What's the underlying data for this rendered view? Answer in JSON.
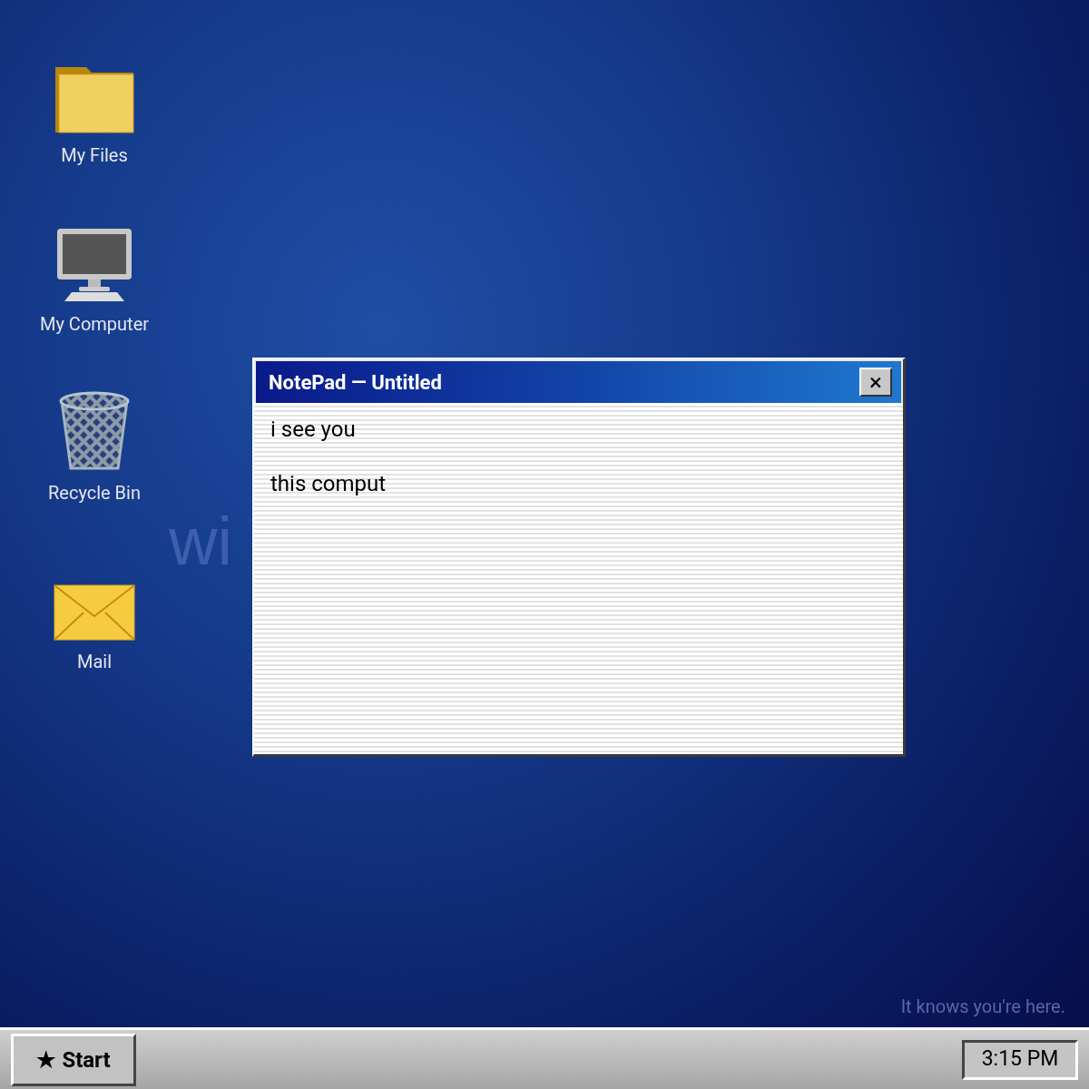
{
  "desktop_icons": [
    {
      "kind": "folder",
      "label": "My Files"
    },
    {
      "kind": "computer",
      "label": "My Computer"
    },
    {
      "kind": "trash",
      "label": "Recycle Bin"
    },
    {
      "kind": "mail",
      "label": "Mail"
    }
  ],
  "wallpaper_text": "wi",
  "window": {
    "title": "NotePad — Untitled",
    "close": "×",
    "lines": [
      "i see you",
      "this comput"
    ]
  },
  "desktop_caption": "It knows you're here.",
  "taskbar": {
    "start_icon": "★",
    "start_label": "Start",
    "clock": "3:15 PM"
  }
}
